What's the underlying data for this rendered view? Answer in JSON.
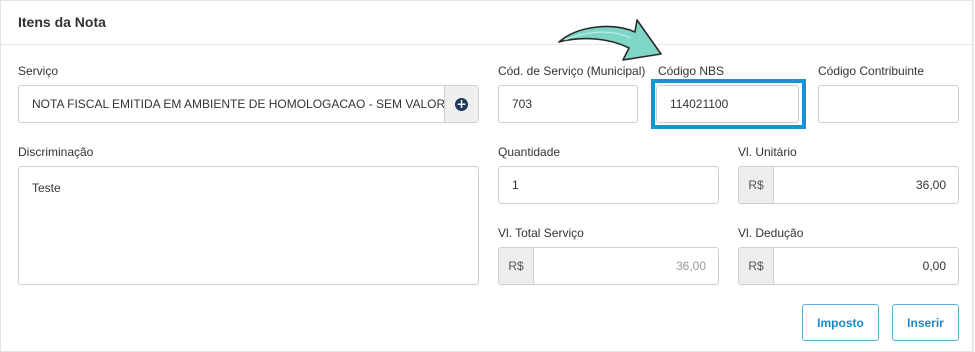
{
  "section": {
    "title": "Itens da Nota"
  },
  "servico": {
    "label": "Serviço",
    "value": "NOTA FISCAL EMITIDA EM AMBIENTE DE HOMOLOGACAO - SEM VALOR FIS",
    "add_icon": "plus-circle-icon"
  },
  "cod_servico": {
    "label": "Cód. de Serviço (Municipal)",
    "value": "703"
  },
  "codigo_nbs": {
    "label": "Código NBS",
    "value": "114021100"
  },
  "codigo_contribuinte": {
    "label": "Código Contribuinte",
    "value": ""
  },
  "discriminacao": {
    "label": "Discriminação",
    "value": "Teste"
  },
  "quantidade": {
    "label": "Quantidade",
    "value": "1"
  },
  "vl_unitario": {
    "label": "Vl. Unitário",
    "prefix": "R$",
    "value": "36,00"
  },
  "vl_total": {
    "label": "Vl. Total Serviço",
    "prefix": "R$",
    "value": "36,00"
  },
  "vl_deducao": {
    "label": "Vl. Dedução",
    "prefix": "R$",
    "value": "0,00"
  },
  "buttons": {
    "imposto": "Imposto",
    "inserir": "Inserir"
  },
  "colors": {
    "accent": "#1e88c7",
    "highlight": "#1893cf",
    "arrow": "#7fd6c6"
  }
}
